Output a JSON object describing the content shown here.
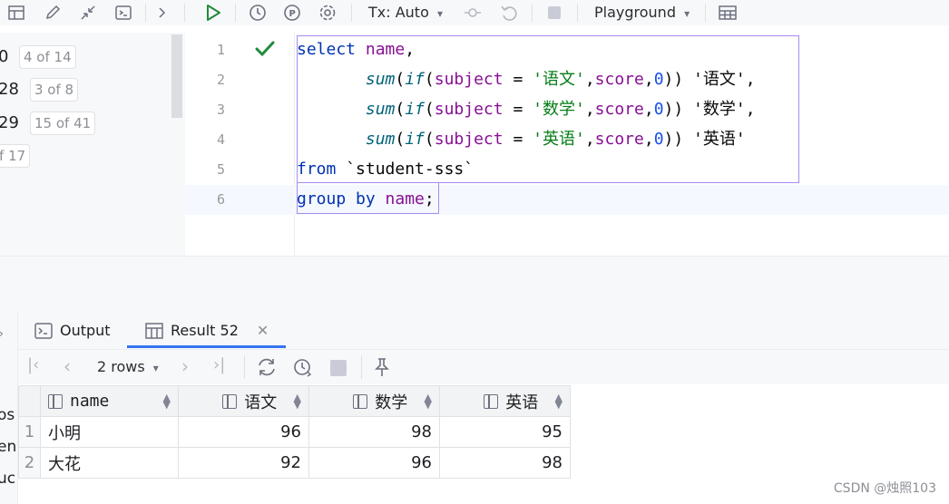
{
  "toolbar": {
    "tx_label": "Tx: Auto",
    "playground_label": "Playground"
  },
  "left_panel": {
    "rows": [
      {
        "num": "0",
        "badge": "4 of 14"
      },
      {
        "num": "28",
        "badge": "3 of 8"
      },
      {
        "num": "29",
        "badge": "15 of 41"
      },
      {
        "num": "",
        "badge": "f 17"
      }
    ],
    "edge_fragments": [
      "os",
      "en",
      "uc"
    ]
  },
  "editor": {
    "line_numbers": [
      "1",
      "2",
      "3",
      "4",
      "5",
      "6"
    ]
  },
  "bottom": {
    "tab_output": "Output",
    "tab_result": "Result 52",
    "rows_label": "2 rows"
  },
  "grid": {
    "columns": [
      "name",
      "语文",
      "数学",
      "英语"
    ],
    "rows": [
      {
        "index": "1",
        "cells": [
          "小明",
          "96",
          "98",
          "95"
        ]
      },
      {
        "index": "2",
        "cells": [
          "大花",
          "92",
          "96",
          "98"
        ]
      }
    ]
  },
  "watermark": "CSDN @烛照103",
  "colors": {
    "accent": "#3574f0",
    "run_green": "#208a3c",
    "selection": "#a68bf0"
  }
}
